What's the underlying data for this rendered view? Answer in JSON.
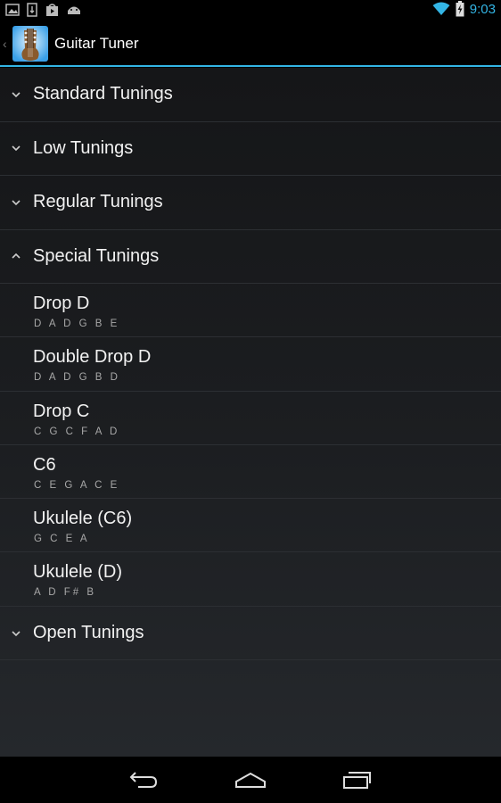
{
  "status_bar": {
    "time": "9:03",
    "left_icons": [
      "image-icon",
      "sd-card-icon",
      "play-store-icon",
      "android-icon"
    ],
    "right_icons": [
      "wifi-icon",
      "battery-charging-icon"
    ],
    "accent_color": "#33b5e5"
  },
  "action_bar": {
    "title": "Guitar Tuner",
    "icon": "guitar-app-icon"
  },
  "groups": [
    {
      "label": "Standard Tunings",
      "expanded": false
    },
    {
      "label": "Low Tunings",
      "expanded": false
    },
    {
      "label": "Regular Tunings",
      "expanded": false
    },
    {
      "label": "Special Tunings",
      "expanded": true,
      "children": [
        {
          "name": "Drop D",
          "notes": "D A D G B E"
        },
        {
          "name": "Double Drop D",
          "notes": "D A D G B D"
        },
        {
          "name": "Drop C",
          "notes": "C G C F A D"
        },
        {
          "name": "C6",
          "notes": "C E G A C E"
        },
        {
          "name": "Ukulele (C6)",
          "notes": "G C E A"
        },
        {
          "name": "Ukulele (D)",
          "notes": "A D F# B"
        }
      ]
    },
    {
      "label": "Open Tunings",
      "expanded": false
    }
  ],
  "nav_bar": {
    "buttons": [
      "back-icon",
      "home-icon",
      "recent-apps-icon"
    ]
  }
}
